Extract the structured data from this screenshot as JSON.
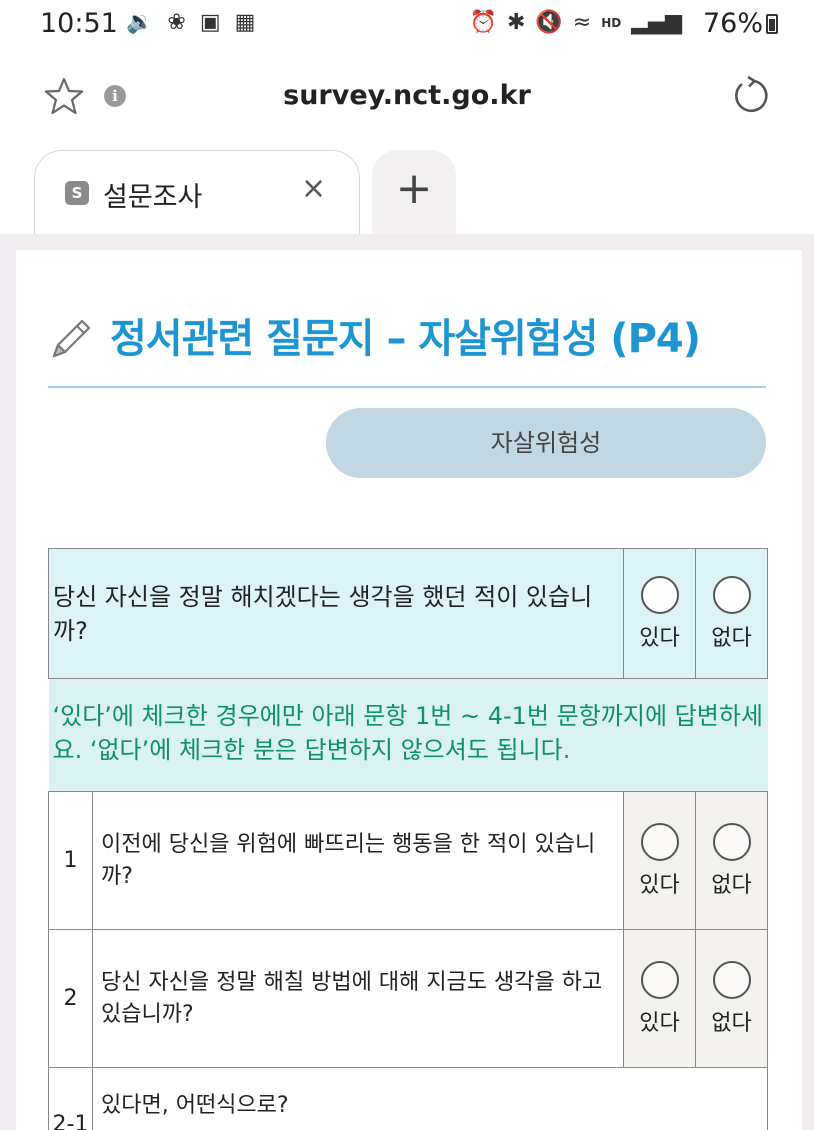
{
  "status_bar": {
    "time": "10:51",
    "battery": "76%",
    "left_icons": [
      "volume-icon",
      "fan-icon",
      "image-icon",
      "screenshot-icon"
    ],
    "right_icons": [
      "alarm-icon",
      "bluetooth-icon",
      "mute-icon",
      "wifi-icon",
      "hd-voice-icon",
      "signal-icon",
      "battery-icon"
    ]
  },
  "browser": {
    "url": "survey.nct.go.kr",
    "info_glyph": "i",
    "tab": {
      "favicon_letter": "S",
      "title": "설문조사",
      "close": "×"
    },
    "new_tab": "+"
  },
  "page": {
    "heading": "정서관련 질문지 – 자살위험성 (P4)",
    "section_button": "자살위험성",
    "main_question": {
      "text": "당신 자신을 정말 해치겠다는 생각을 했던 적이 있습니까?",
      "options": [
        "있다",
        "없다"
      ]
    },
    "notice": "‘있다’에 체크한 경우에만 아래 문항 1번 ~ 4-1번 문항까지에 답변하세요. ‘없다’에 체크한 분은 답변하지 않으셔도 됩니다.",
    "questions": [
      {
        "num": "1",
        "text": "이전에 당신을 위험에 빠뜨리는 행동을 한 적이 있습니까?",
        "options": [
          "있다",
          "없다"
        ]
      },
      {
        "num": "2",
        "text": "당신 자신을 정말 해칠 방법에 대해 지금도 생각을 하고 있습니까?",
        "options": [
          "있다",
          "없다"
        ]
      },
      {
        "num": "2-1",
        "text": "있다면, 어떤식으로?"
      }
    ]
  },
  "colors": {
    "heading": "#1c95d2",
    "notice_text": "#0f8f6d",
    "question_bg": "#def3f7",
    "pill_bg": "#c2d7e2",
    "page_bg": "#efebee"
  }
}
